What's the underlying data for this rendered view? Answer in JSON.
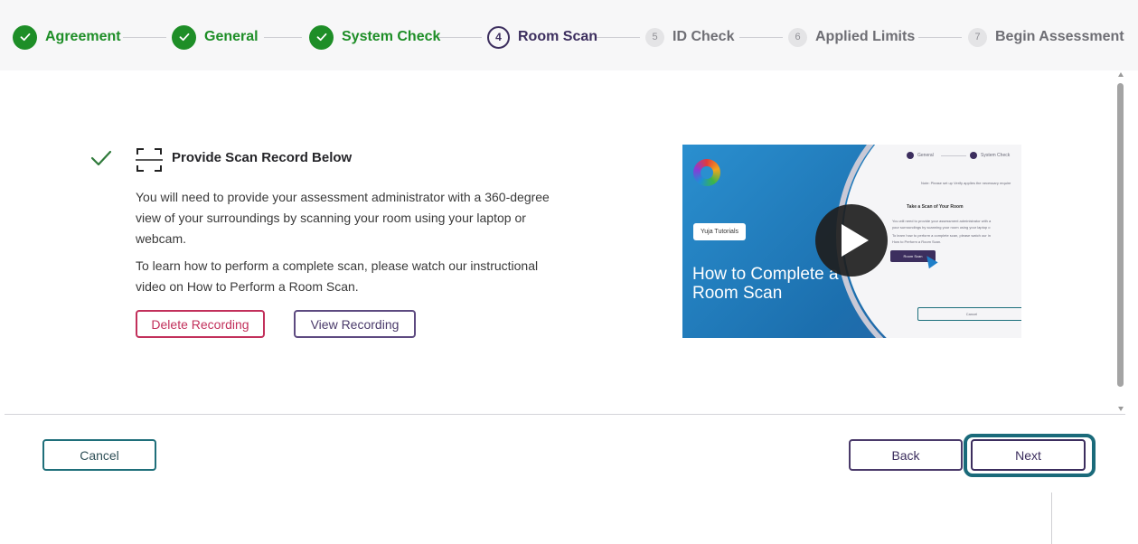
{
  "stepper": {
    "steps": [
      {
        "number": "1",
        "label": "Agreement",
        "status": "completed"
      },
      {
        "number": "2",
        "label": "General",
        "status": "completed"
      },
      {
        "number": "3",
        "label": "System Check",
        "status": "completed"
      },
      {
        "number": "4",
        "label": "Room Scan",
        "status": "active"
      },
      {
        "number": "5",
        "label": "ID Check",
        "status": "pending"
      },
      {
        "number": "6",
        "label": "Applied Limits",
        "status": "pending"
      },
      {
        "number": "7",
        "label": "Begin Assessment",
        "status": "pending"
      }
    ]
  },
  "section": {
    "title": "Provide Scan Record Below",
    "paragraph1": "You will need to provide your assessment administrator with a 360-degree view of your surroundings by scanning your room using your laptop or webcam.",
    "paragraph2": "To learn how to perform a complete scan, please watch our instructional video on How to Perform a Room Scan.",
    "delete_label": "Delete Recording",
    "view_label": "View Recording"
  },
  "video": {
    "tag": "Yuja Tutorials",
    "title": "How to Complete a Room Scan",
    "mini_general": "General",
    "mini_system_check": "System Check",
    "mini_note": "Note: Please set up Verify applies the necessary require",
    "mini_heading": "Take a Scan of Your Room",
    "mini_text1": "You will need to provide your assessment administrator with a",
    "mini_text2": "your surroundings by scanning your room using your laptop o",
    "mini_text3": "To learn how to perform a complete scan, please watch our in",
    "mini_text4": "How to Perform a Room Scan.",
    "mini_button": "Room Scan",
    "mini_cancel": "Cancel"
  },
  "footer": {
    "cancel_label": "Cancel",
    "back_label": "Back",
    "next_label": "Next"
  },
  "colors": {
    "completed": "#1e8e27",
    "active": "#3c2e5e",
    "delete": "#c2305b",
    "focus": "#1a6a7a"
  }
}
